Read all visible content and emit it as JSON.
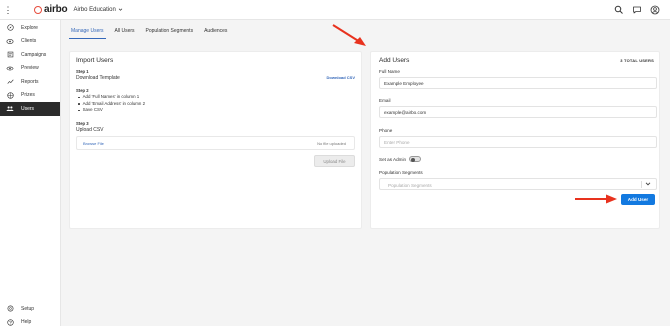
{
  "header": {
    "logo_text": "airbo",
    "org_name": "Airbo Education",
    "icons": [
      "search-icon",
      "chat-icon",
      "user-icon"
    ]
  },
  "sidebar": {
    "items": [
      {
        "label": "Explore",
        "icon": "explore-icon",
        "active": false
      },
      {
        "label": "Clients",
        "icon": "clients-icon",
        "active": false
      },
      {
        "label": "Campaigns",
        "icon": "campaigns-icon",
        "active": false
      },
      {
        "label": "Preview",
        "icon": "preview-icon",
        "active": false
      },
      {
        "label": "Reports",
        "icon": "reports-icon",
        "active": false
      },
      {
        "label": "Prizes",
        "icon": "prizes-icon",
        "active": false
      },
      {
        "label": "Users",
        "icon": "users-icon",
        "active": true
      }
    ],
    "bottom_items": [
      {
        "label": "Setup",
        "icon": "setup-icon"
      },
      {
        "label": "Help",
        "icon": "help-icon"
      }
    ]
  },
  "tabs": [
    {
      "label": "Manage Users",
      "active": true
    },
    {
      "label": "All Users",
      "active": false
    },
    {
      "label": "Population Segments",
      "active": false
    },
    {
      "label": "Audiences",
      "active": false
    }
  ],
  "import": {
    "title": "Import Users",
    "step1_label": "Step 1",
    "step1_text": "Download Template",
    "download_link": "Download CSV",
    "step2_label": "Step 2",
    "step2_bullets": [
      "Add 'Full Names' in column 1",
      "Add 'Email Address' in column 2",
      "Save CSV"
    ],
    "step3_label": "Step 3",
    "step3_text": "Upload CSV",
    "browse_label": "Browse File",
    "no_file_label": "No file uploaded",
    "upload_button": "Upload File"
  },
  "add_user": {
    "title": "Add Users",
    "total_users": "3 TOTAL USERS",
    "full_name_label": "Full Name",
    "full_name_value": "Example Employee",
    "email_label": "Email",
    "email_value": "example@airbo.com",
    "phone_label": "Phone",
    "phone_placeholder": "Enter Phone",
    "admin_label": "Set as Admin",
    "admin_enabled": false,
    "segments_label": "Population Segments",
    "segments_placeholder": "Population Segments",
    "add_button": "Add User"
  },
  "colors": {
    "accent": "#3568b9",
    "primary_button": "#1279e0",
    "annotation_arrow": "#e8321e",
    "active_nav": "#2b2b2b"
  }
}
